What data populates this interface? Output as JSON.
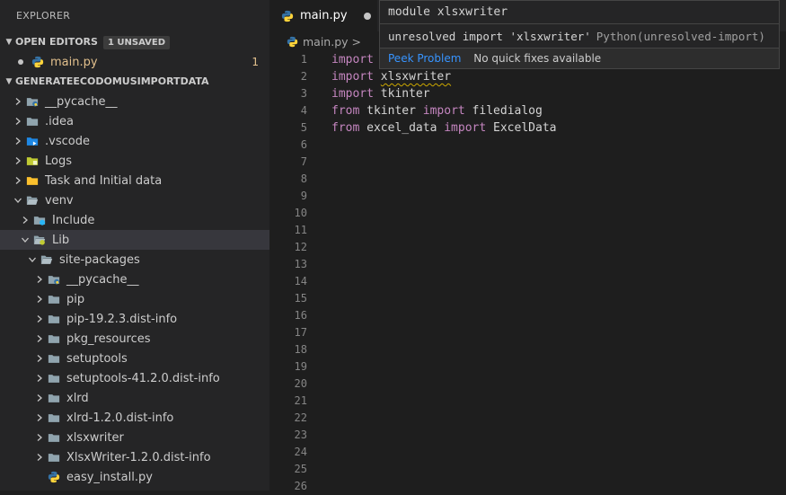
{
  "sidebar": {
    "title": "EXPLORER",
    "open_editors": {
      "header": "OPEN EDITORS",
      "badge": "1 UNSAVED",
      "items": [
        {
          "name": "main.py",
          "problems": "1"
        }
      ]
    },
    "project": {
      "header": "GENERATEECODOMUSIMPORTDATA"
    },
    "tree": [
      {
        "label": "__pycache__",
        "indent": 1,
        "expanded": false,
        "icon": "folder-python",
        "selected": false
      },
      {
        "label": ".idea",
        "indent": 1,
        "expanded": false,
        "icon": "folder",
        "selected": false
      },
      {
        "label": ".vscode",
        "indent": 1,
        "expanded": false,
        "icon": "folder-vscode",
        "selected": false
      },
      {
        "label": "Logs",
        "indent": 1,
        "expanded": false,
        "icon": "folder-logs",
        "selected": false
      },
      {
        "label": "Task and Initial data",
        "indent": 1,
        "expanded": false,
        "icon": "folder-yellow",
        "selected": false
      },
      {
        "label": "venv",
        "indent": 1,
        "expanded": true,
        "icon": "folder-open",
        "selected": false
      },
      {
        "label": "Include",
        "indent": 2,
        "expanded": false,
        "icon": "folder-include",
        "selected": false
      },
      {
        "label": "Lib",
        "indent": 2,
        "expanded": true,
        "icon": "folder-lib",
        "selected": true
      },
      {
        "label": "site-packages",
        "indent": 3,
        "expanded": true,
        "icon": "folder-open",
        "selected": false
      },
      {
        "label": "__pycache__",
        "indent": 4,
        "expanded": false,
        "icon": "folder-python",
        "selected": false
      },
      {
        "label": "pip",
        "indent": 4,
        "expanded": false,
        "icon": "folder",
        "selected": false
      },
      {
        "label": "pip-19.2.3.dist-info",
        "indent": 4,
        "expanded": false,
        "icon": "folder",
        "selected": false
      },
      {
        "label": "pkg_resources",
        "indent": 4,
        "expanded": false,
        "icon": "folder",
        "selected": false
      },
      {
        "label": "setuptools",
        "indent": 4,
        "expanded": false,
        "icon": "folder",
        "selected": false
      },
      {
        "label": "setuptools-41.2.0.dist-info",
        "indent": 4,
        "expanded": false,
        "icon": "folder",
        "selected": false
      },
      {
        "label": "xlrd",
        "indent": 4,
        "expanded": false,
        "icon": "folder",
        "selected": false
      },
      {
        "label": "xlrd-1.2.0.dist-info",
        "indent": 4,
        "expanded": false,
        "icon": "folder",
        "selected": false
      },
      {
        "label": "xlsxwriter",
        "indent": 4,
        "expanded": false,
        "icon": "folder",
        "selected": false
      },
      {
        "label": "XlsxWriter-1.2.0.dist-info",
        "indent": 4,
        "expanded": false,
        "icon": "folder",
        "selected": false
      },
      {
        "label": "easy_install.py",
        "indent": 4,
        "expanded": null,
        "icon": "file-python",
        "selected": false
      }
    ]
  },
  "editor": {
    "tab": {
      "label": "main.py"
    },
    "breadcrumb": {
      "file": "main.py",
      "separator": ">"
    },
    "line_numbers": [
      "1",
      "2",
      "3",
      "4",
      "5",
      "6",
      "7",
      "8",
      "9",
      "10",
      "11",
      "12",
      "13",
      "14",
      "15",
      "16",
      "17",
      "18",
      "19",
      "20",
      "21",
      "22",
      "23",
      "24",
      "25",
      "26"
    ],
    "lines": [
      [
        {
          "t": "import",
          "c": "kw"
        }
      ],
      [
        {
          "t": "import",
          "c": "kw"
        },
        {
          "t": " "
        },
        {
          "t": "xlsxwriter",
          "c": "squig"
        }
      ],
      [
        {
          "t": "import",
          "c": "kw"
        },
        {
          "t": " tkinter"
        }
      ],
      [
        {
          "t": "from",
          "c": "kw"
        },
        {
          "t": " tkinter "
        },
        {
          "t": "import",
          "c": "kw"
        },
        {
          "t": " filedialog"
        }
      ],
      [
        {
          "t": "from",
          "c": "kw"
        },
        {
          "t": " excel_data "
        },
        {
          "t": "import",
          "c": "kw"
        },
        {
          "t": " ExcelData"
        }
      ]
    ]
  },
  "hover": {
    "signature": "module xlsxwriter",
    "message": "unresolved import 'xlsxwriter'",
    "source": "Python(unresolved-import)",
    "peek_label": "Peek Problem",
    "no_fix_label": "No quick fixes available"
  },
  "colors": {
    "keyword": "#c586c0",
    "folder": "#90a4ae",
    "python_blue": "#3572a5",
    "python_yellow": "#ffd43b",
    "modified": "#e2c08d",
    "link": "#3794ff"
  }
}
